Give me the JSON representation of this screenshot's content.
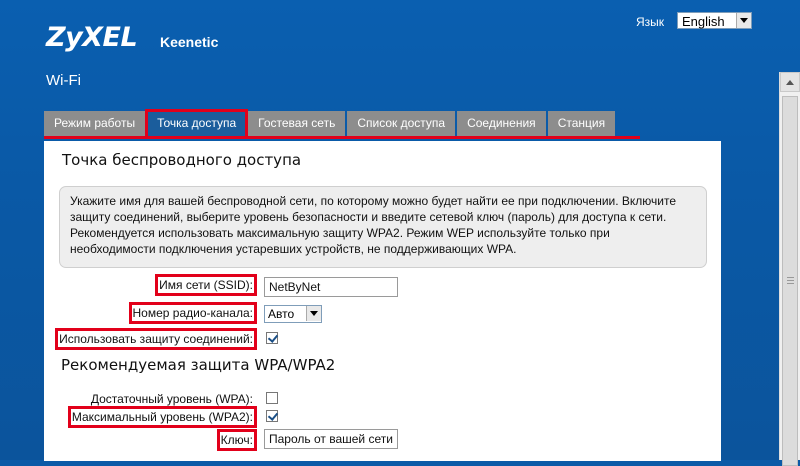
{
  "header": {
    "logo": "ZyXEL",
    "product": "Keenetic",
    "language_label": "Язык",
    "language_value": "English"
  },
  "page": {
    "title": "Wi-Fi"
  },
  "tabs": [
    {
      "label": "Режим работы",
      "active": false
    },
    {
      "label": "Точка доступа",
      "active": true
    },
    {
      "label": "Гостевая сеть",
      "active": false
    },
    {
      "label": "Список доступа",
      "active": false
    },
    {
      "label": "Соединения",
      "active": false
    },
    {
      "label": "Станция",
      "active": false
    }
  ],
  "panel": {
    "title": "Точка беспроводного доступа",
    "info_lines": [
      "Укажите имя для вашей беспроводной сети, по которому можно будет найти ее при подключении. Включите",
      "защиту соединений, выберите уровень безопасности и введите сетевой ключ (пароль) для доступа к сети.",
      "Рекомендуется использовать максимальную защиту WPA2. Режим WEP используйте только при",
      "необходимости подключения устаревших устройств, не поддерживающих WPA."
    ]
  },
  "form": {
    "ssid_label": "Имя сети (SSID):",
    "ssid_value": "NetByNet",
    "channel_label": "Номер радио-канала:",
    "channel_value": "Авто",
    "protection_label": "Использовать защиту соединений:",
    "protection_checked": true,
    "wpa_section_title": "Рекомендуемая защита WPA/WPA2",
    "wpa_label": "Достаточный уровень (WPA):",
    "wpa_checked": false,
    "wpa2_label": "Максимальный уровень (WPA2):",
    "wpa2_checked": true,
    "key_label": "Ключ:",
    "key_value": "Пароль от вашей сети"
  },
  "icons": {
    "dropdown": "chevron-down-icon",
    "checkbox": "checkbox-icon",
    "scroll_up": "arrow-up-icon"
  },
  "colors": {
    "header_bg": "#0a5fb0",
    "tab_bg": "#8d8d8d",
    "tab_active_bg": "#1b5d9c",
    "highlight_red": "#e2001a"
  }
}
